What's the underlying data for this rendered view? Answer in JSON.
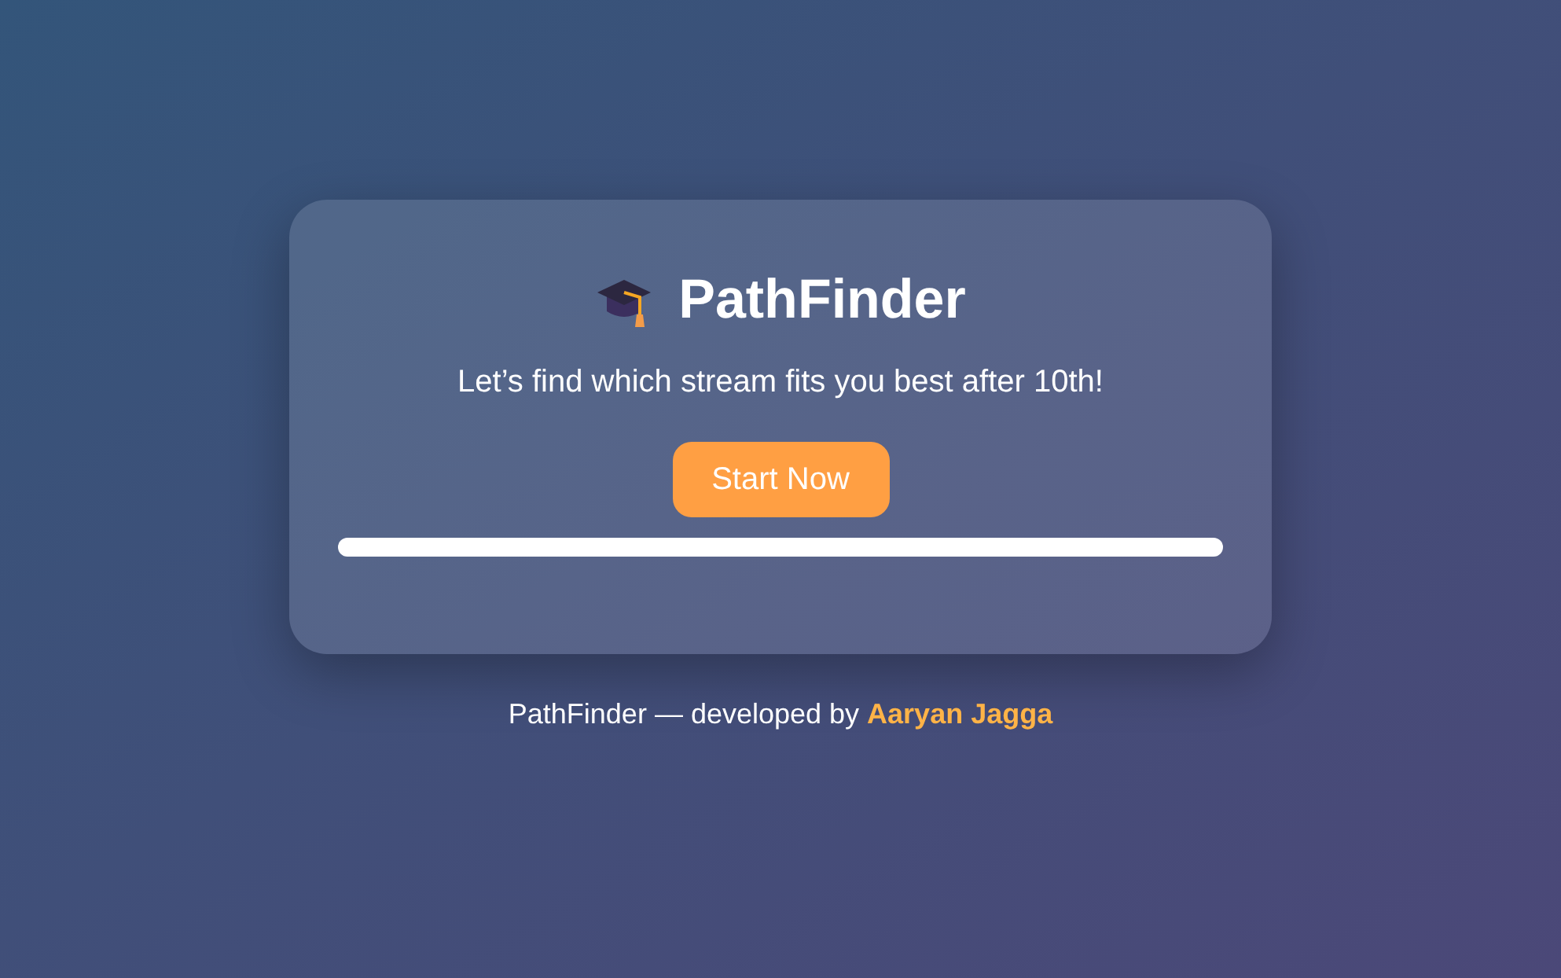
{
  "card": {
    "title": "PathFinder",
    "subtitle": "Let’s find which stream fits you best after 10th!",
    "start_button": "Start Now",
    "progress": {
      "level": 0
    }
  },
  "footer": {
    "text": "PathFinder — developed by",
    "author": "Aaryan Jagga"
  }
}
